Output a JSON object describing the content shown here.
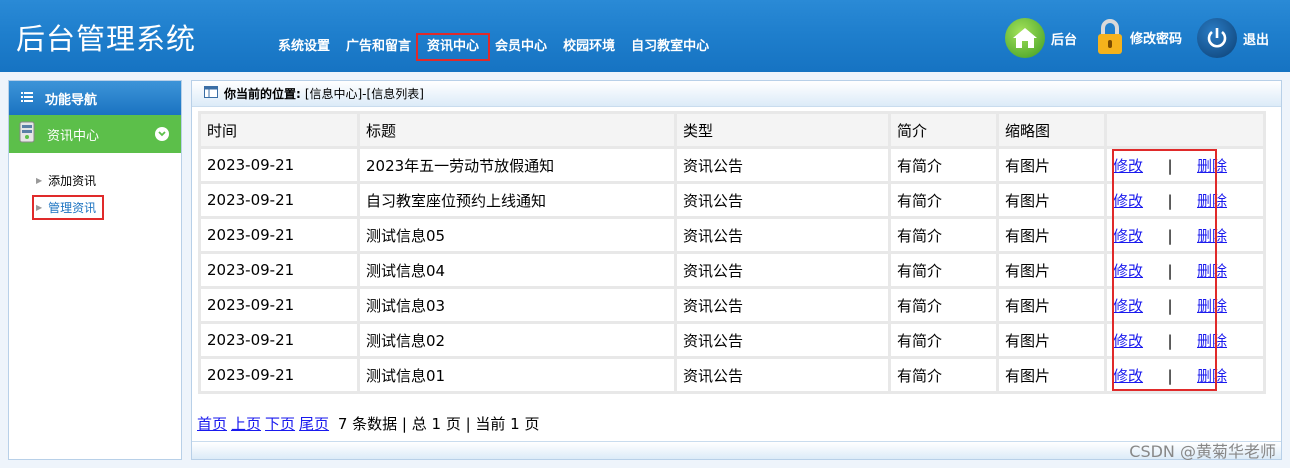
{
  "header": {
    "title": "后台管理系统",
    "nav": [
      {
        "label": "系统设置",
        "active": false
      },
      {
        "label": "广告和留言",
        "active": false
      },
      {
        "label": "资讯中心",
        "active": true
      },
      {
        "label": "会员中心",
        "active": false
      },
      {
        "label": "校园环境",
        "active": false
      },
      {
        "label": "自习教室中心",
        "active": false
      }
    ],
    "tools": {
      "home": "后台",
      "password": "修改密码",
      "logout": "退出"
    }
  },
  "sidebar": {
    "title": "功能导航",
    "section": "资讯中心",
    "items": [
      {
        "label": "添加资讯",
        "active": false
      },
      {
        "label": "管理资讯",
        "active": true
      }
    ]
  },
  "main": {
    "breadcrumb_label": "你当前的位置:",
    "breadcrumb_path": "[信息中心]-[信息列表]",
    "columns": [
      "时间",
      "标题",
      "类型",
      "简介",
      "缩略图",
      ""
    ],
    "rows": [
      {
        "time": "2023-09-21",
        "title": "2023年五一劳动节放假通知",
        "type": "资讯公告",
        "intro": "有简介",
        "thumb": "有图片"
      },
      {
        "time": "2023-09-21",
        "title": "自习教室座位预约上线通知",
        "type": "资讯公告",
        "intro": "有简介",
        "thumb": "有图片"
      },
      {
        "time": "2023-09-21",
        "title": "测试信息05",
        "type": "资讯公告",
        "intro": "有简介",
        "thumb": "有图片"
      },
      {
        "time": "2023-09-21",
        "title": "测试信息04",
        "type": "资讯公告",
        "intro": "有简介",
        "thumb": "有图片"
      },
      {
        "time": "2023-09-21",
        "title": "测试信息03",
        "type": "资讯公告",
        "intro": "有简介",
        "thumb": "有图片"
      },
      {
        "time": "2023-09-21",
        "title": "测试信息02",
        "type": "资讯公告",
        "intro": "有简介",
        "thumb": "有图片"
      },
      {
        "time": "2023-09-21",
        "title": "测试信息01",
        "type": "资讯公告",
        "intro": "有简介",
        "thumb": "有图片"
      }
    ],
    "actions": {
      "edit": "修改",
      "separator": "|",
      "delete": "删除"
    },
    "pager": {
      "first": "首页",
      "prev": "上页",
      "next": "下页",
      "last": "尾页",
      "summary": "7 条数据 | 总 1 页 | 当前 1 页"
    }
  },
  "watermark": "CSDN @黄菊华老师",
  "colors": {
    "header": "#1f7fcd",
    "section": "#5cbf4a",
    "highlight": "#e02a2a",
    "link": "#1a1aee"
  }
}
